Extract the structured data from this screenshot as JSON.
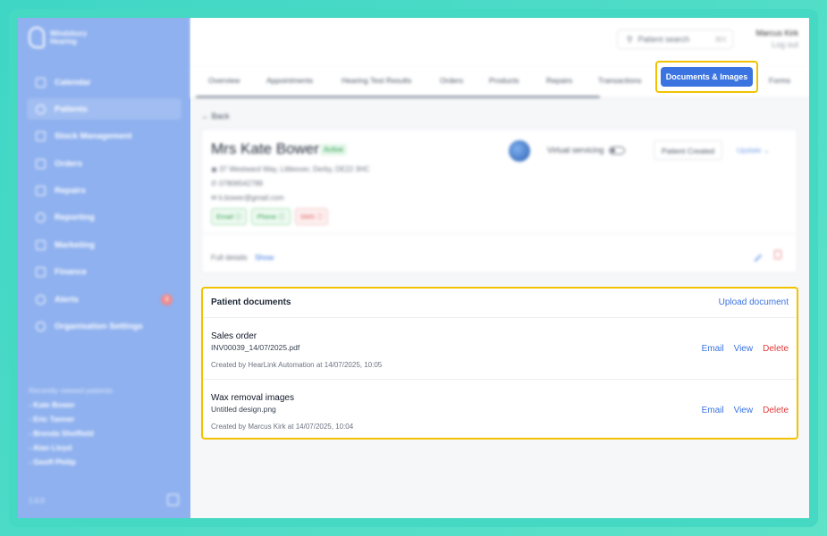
{
  "sidebar": {
    "brand": [
      "Windsbury",
      "Hearing"
    ],
    "items": [
      {
        "label": "Calendar",
        "icon": "calendar-icon"
      },
      {
        "label": "Patients",
        "icon": "patients-icon",
        "active": true
      },
      {
        "label": "Stock Management",
        "icon": "stock-icon"
      },
      {
        "label": "Orders",
        "icon": "orders-icon"
      },
      {
        "label": "Repairs",
        "icon": "wrench-icon"
      },
      {
        "label": "Reporting",
        "icon": "chart-icon"
      },
      {
        "label": "Marketing",
        "icon": "mail-icon"
      },
      {
        "label": "Finance",
        "icon": "card-icon"
      },
      {
        "label": "Alerts",
        "icon": "bell-icon",
        "badge": "3"
      },
      {
        "label": "Organisation Settings",
        "icon": "gear-icon"
      }
    ],
    "recent_title": "Recently viewed patients",
    "recent": [
      "Kate Bower",
      "Eric Tanner",
      "Brenda Sheffield",
      "Alan Lloyd",
      "Geoff Philip"
    ],
    "version": "1.0.0"
  },
  "topbar": {
    "search_placeholder": "Patient search",
    "search_shortcut": "⌘K",
    "user_name": "Marcus Kirk",
    "logout": "Log out"
  },
  "tabs": [
    "Overview",
    "Appointments",
    "Hearing Test Results",
    "Orders",
    "Products",
    "Repairs",
    "Transactions",
    "Documents & Images",
    "Forms"
  ],
  "active_tab": "Documents & Images",
  "back_label": "Back",
  "patient": {
    "name": "Mrs Kate Bower",
    "status": "Active",
    "address": "37 Westward Way, Littleover, Derby, DE22 3HC",
    "phone": "07806542789",
    "email": "k.bower@gmail.com",
    "chips": [
      {
        "label": "Email ⓘ",
        "tone": "g"
      },
      {
        "label": "Phone ⓘ",
        "tone": "g"
      },
      {
        "label": "SMS ⓘ",
        "tone": "r"
      }
    ],
    "virtual_servicing": "Virtual servicing",
    "created": "Patient Created",
    "update": "Update",
    "full_details": "Full details",
    "show": "Show"
  },
  "documents": {
    "title": "Patient documents",
    "upload_label": "Upload document",
    "actions": {
      "email": "Email",
      "view": "View",
      "delete": "Delete"
    },
    "items": [
      {
        "name": "Sales order",
        "file": "INV00039_14/07/2025.pdf",
        "meta": "Created by HearLink Automation at 14/07/2025, 10:05"
      },
      {
        "name": "Wax removal images",
        "file": "Untitled design.png",
        "meta": "Created by Marcus Kirk at 14/07/2025, 10:04"
      }
    ]
  },
  "colors": {
    "accent": "#3b74e0",
    "highlight": "#f2c200",
    "sidebar": "#8fb1ef",
    "frame": "#45d8c3"
  }
}
